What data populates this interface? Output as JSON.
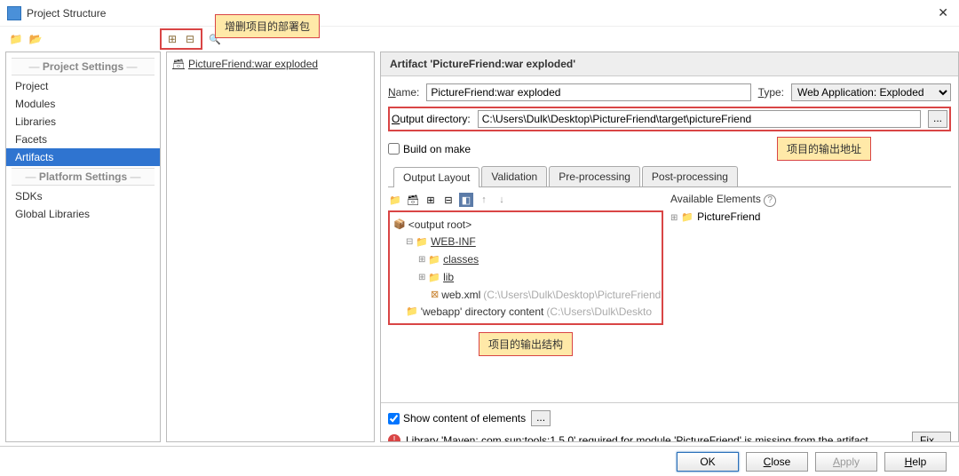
{
  "window": {
    "title": "Project Structure"
  },
  "callouts": {
    "top": "增删项目的部署包",
    "outdir": "项目的输出地址",
    "structure": "项目的输出结构"
  },
  "sidebar": {
    "h1": "Project Settings",
    "h2": "Platform Settings",
    "items1": [
      "Project",
      "Modules",
      "Libraries",
      "Facets",
      "Artifacts"
    ],
    "items2": [
      "SDKs",
      "Global Libraries"
    ],
    "selected": "Artifacts"
  },
  "mid": {
    "artifact": "PictureFriend:war exploded"
  },
  "detail": {
    "header": "Artifact 'PictureFriend:war exploded'",
    "name_lbl": "Name:",
    "name_val": "PictureFriend:war exploded",
    "type_lbl": "Type:",
    "type_val": "Web Application: Exploded",
    "outdir_lbl": "Output directory:",
    "outdir_val": "C:\\Users\\Dulk\\Desktop\\PictureFriend\\target\\pictureFriend",
    "build_chk": "Build on make",
    "tabs": [
      "Output Layout",
      "Validation",
      "Pre-processing",
      "Post-processing"
    ],
    "tree": {
      "root": "<output root>",
      "webinf": "WEB-INF",
      "classes": "classes",
      "lib": "lib",
      "webxml": "web.xml",
      "webxml_hint": "(C:\\Users\\Dulk\\Desktop\\PictureFriend",
      "webapp": "'webapp' directory content",
      "webapp_hint": "(C:\\Users\\Dulk\\Deskto"
    },
    "avail_h": "Available Elements",
    "avail_item": "PictureFriend",
    "show_content": "Show content of elements",
    "err": "Library 'Maven: com.sun:tools:1.5.0' required for module 'PictureFriend' is missing from the artifact",
    "fix": "Fix..."
  },
  "buttons": {
    "ok": "OK",
    "close": "Close",
    "apply": "Apply",
    "help": "Help"
  }
}
